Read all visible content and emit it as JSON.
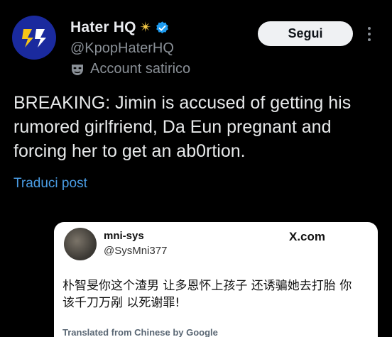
{
  "author": {
    "display_name": "Hater HQ",
    "badge_icon": "star-sparkle-icon",
    "verified_icon": "verified-badge-icon",
    "handle": "@KpopHaterHQ",
    "account_label": "Account satirico",
    "account_label_icon": "mask-icon"
  },
  "actions": {
    "follow_label": "Segui",
    "more_icon": "more-options-icon"
  },
  "post": {
    "text": "BREAKING: Jimin is accused of getting his rumored girlfriend, Da Eun pregnant and forcing her to get an ab0rtion.",
    "translate_label": "Traduci post"
  },
  "embedded": {
    "name": "mni-sys",
    "handle": "@SysMni377",
    "source_label": "X.com",
    "text": "朴智旻你这个渣男 让多恩怀上孩子 还诱骗她去打胎 你该千刀万剐 以死谢罪!",
    "translated_label": "Translated from Chinese by Google"
  },
  "colors": {
    "background": "#000000",
    "link": "#4a9de5",
    "verified": "#1d9bf0",
    "avatar_bg": "#1a2a9e"
  }
}
